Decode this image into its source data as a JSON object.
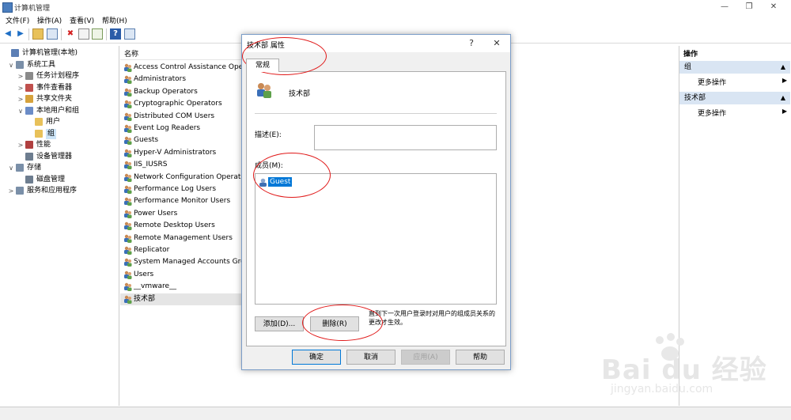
{
  "window": {
    "title": "计算机管理"
  },
  "menu": [
    "文件(F)",
    "操作(A)",
    "查看(V)",
    "帮助(H)"
  ],
  "tree": [
    {
      "label": "计算机管理(本地)",
      "level": 0,
      "arrow": "",
      "icon": "computer-icon",
      "color": "#5c7fb5"
    },
    {
      "label": "系统工具",
      "level": 1,
      "arrow": "∨",
      "icon": "tools-icon",
      "color": "#7a8fa8"
    },
    {
      "label": "任务计划程序",
      "level": 2,
      "arrow": ">",
      "icon": "clock-icon",
      "color": "#8a8a8a"
    },
    {
      "label": "事件查看器",
      "level": 2,
      "arrow": ">",
      "icon": "event-icon",
      "color": "#c0504d"
    },
    {
      "label": "共享文件夹",
      "level": 2,
      "arrow": ">",
      "icon": "share-icon",
      "color": "#d6a23c"
    },
    {
      "label": "本地用户和组",
      "level": 2,
      "arrow": "∨",
      "icon": "users-icon",
      "color": "#6b8cc7"
    },
    {
      "label": "用户",
      "level": 3,
      "arrow": "",
      "icon": "folder-icon",
      "color": "#e8c15a"
    },
    {
      "label": "组",
      "level": 3,
      "arrow": "",
      "icon": "folder-icon",
      "color": "#e8c15a",
      "selected": true
    },
    {
      "label": "性能",
      "level": 2,
      "arrow": ">",
      "icon": "performance-icon",
      "color": "#b04040"
    },
    {
      "label": "设备管理器",
      "level": 2,
      "arrow": "",
      "icon": "device-icon",
      "color": "#6d7d8f"
    },
    {
      "label": "存储",
      "level": 1,
      "arrow": "∨",
      "icon": "storage-icon",
      "color": "#7a8fa8"
    },
    {
      "label": "磁盘管理",
      "level": 2,
      "arrow": "",
      "icon": "disk-icon",
      "color": "#6d7d8f"
    },
    {
      "label": "服务和应用程序",
      "level": 1,
      "arrow": ">",
      "icon": "services-icon",
      "color": "#7a8fa8"
    }
  ],
  "list": {
    "header": "名称",
    "items": [
      "Access Control Assistance Operators",
      "Administrators",
      "Backup Operators",
      "Cryptographic Operators",
      "Distributed COM Users",
      "Event Log Readers",
      "Guests",
      "Hyper-V Administrators",
      "IIS_IUSRS",
      "Network Configuration Operators",
      "Performance Log Users",
      "Performance Monitor Users",
      "Power Users",
      "Remote Desktop Users",
      "Remote Management Users",
      "Replicator",
      "System Managed Accounts Group",
      "Users",
      "__vmware__",
      "技术部"
    ],
    "selected_index": 19
  },
  "actions": {
    "header": "操作",
    "sections": [
      {
        "title": "组",
        "items": [
          "更多操作"
        ]
      },
      {
        "title": "技术部",
        "items": [
          "更多操作"
        ]
      }
    ]
  },
  "dialog": {
    "title": "技术部 属性",
    "help": "?",
    "close": "✕",
    "tab": "常规",
    "group_name": "技术部",
    "description_label": "描述(E):",
    "description_value": "",
    "members_label": "成员(M):",
    "members": [
      "Guest"
    ],
    "add_button": "添加(D)...",
    "remove_button": "删除(R)",
    "note": "直到下一次用户登录时对用户的组成员关系的更改才生效。",
    "ok": "确定",
    "cancel": "取消",
    "apply": "应用(A)",
    "help_button": "帮助"
  },
  "watermark": {
    "line1": "Bai du 经验",
    "line2": "jingyan.baidu.com"
  },
  "colors": {
    "accent": "#0078d7",
    "selection": "#0078d7",
    "annotation": "#e01818",
    "action_section": "#d9e5f3"
  }
}
